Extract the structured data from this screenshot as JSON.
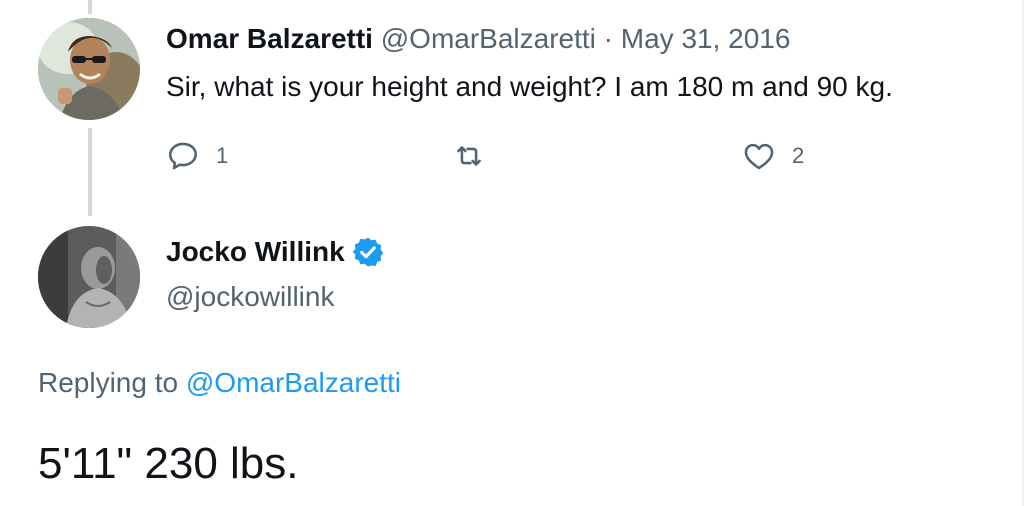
{
  "parent_tweet": {
    "author_name": "Omar Balzaretti",
    "handle": "@OmarBalzaretti",
    "separator": "·",
    "date": "May 31, 2016",
    "text": "Sir, what is your height and weight? I am 180 m and 90 kg.",
    "avatar_icon": "profile-photo",
    "actions": {
      "reply": {
        "icon": "reply-icon",
        "count": "1"
      },
      "retweet": {
        "icon": "retweet-icon",
        "count": ""
      },
      "like": {
        "icon": "heart-icon",
        "count": "2"
      }
    }
  },
  "reply_tweet": {
    "author_name": "Jocko Willink",
    "verified_icon": "verified-badge-icon",
    "handle": "@jockowillink",
    "replying_prefix": "Replying to",
    "replying_to": "@OmarBalzaretti",
    "text": "5'11\" 230 lbs.",
    "avatar_icon": "profile-photo"
  },
  "colors": {
    "text_primary": "#0f1419",
    "text_secondary": "#536471",
    "accent": "#1d9bf0",
    "thread_line": "#cfd9de"
  }
}
